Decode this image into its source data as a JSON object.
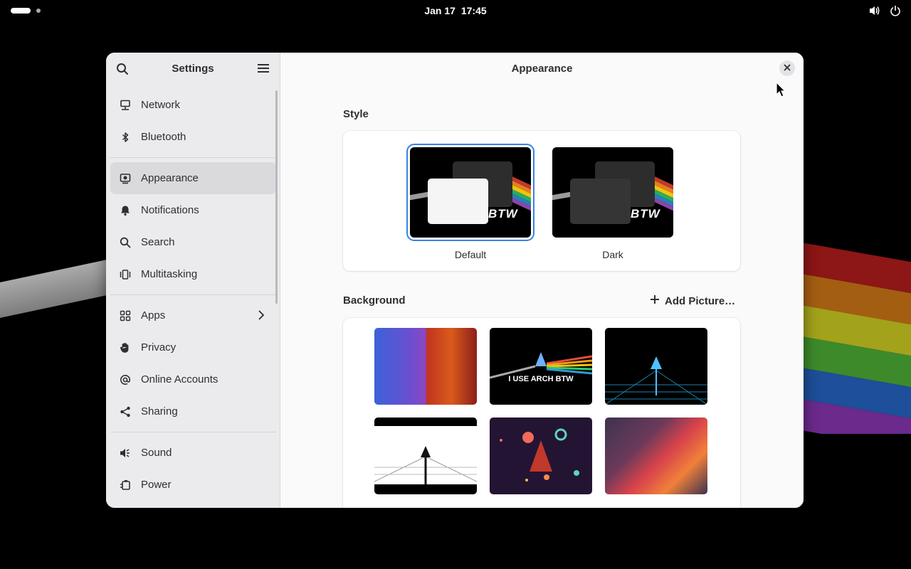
{
  "topbar": {
    "date": "Jan 17",
    "time": "17:45",
    "icons": [
      "activities-indicator",
      "volume-icon",
      "power-icon"
    ]
  },
  "sidebar": {
    "title": "Settings",
    "items": [
      {
        "label": "Network",
        "icon": "network-icon"
      },
      {
        "label": "Bluetooth",
        "icon": "bluetooth-icon"
      },
      {
        "label": "Appearance",
        "icon": "appearance-icon",
        "active": true
      },
      {
        "label": "Notifications",
        "icon": "bell-icon"
      },
      {
        "label": "Search",
        "icon": "search-icon"
      },
      {
        "label": "Multitasking",
        "icon": "multitasking-icon"
      },
      {
        "label": "Apps",
        "icon": "apps-icon"
      },
      {
        "label": "Privacy",
        "icon": "hand-icon"
      },
      {
        "label": "Online Accounts",
        "icon": "at-icon"
      },
      {
        "label": "Sharing",
        "icon": "share-icon"
      },
      {
        "label": "Sound",
        "icon": "speaker-icon"
      },
      {
        "label": "Power",
        "icon": "battery-icon"
      }
    ]
  },
  "content": {
    "title": "Appearance",
    "style_section": "Style",
    "style_options": [
      {
        "label": "Default",
        "selected": true
      },
      {
        "label": "Dark",
        "selected": false
      }
    ],
    "thumb_text": "BTW",
    "background_section": "Background",
    "add_picture": "Add Picture…",
    "wallpaper_text": "I USE ARCH BTW"
  },
  "colors": {
    "accent": "#3584e4",
    "sidebar_bg": "#ebebed",
    "content_bg": "#fafafa"
  }
}
